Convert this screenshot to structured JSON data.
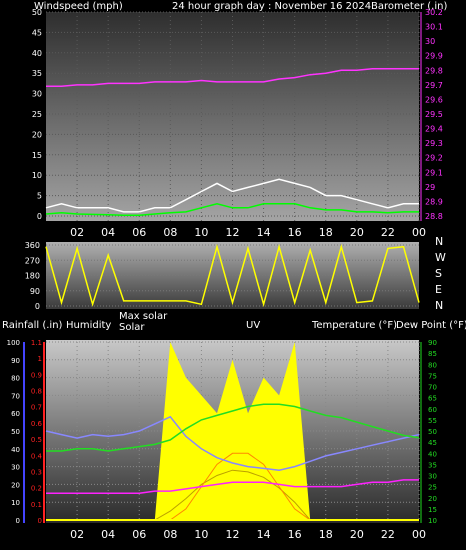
{
  "header": {
    "wind_label": "Windspeed (mph)",
    "title": "24 hour graph day : November 16 2024",
    "baro_label": "Barometer (.in)"
  },
  "x_ticks": [
    "02",
    "04",
    "06",
    "08",
    "10",
    "12",
    "14",
    "16",
    "18",
    "20",
    "22",
    "00"
  ],
  "dir_labels": [
    "N",
    "W",
    "S",
    "E",
    "N"
  ],
  "lower_labels": {
    "rain": "Rainfall (.in)",
    "humidity": "Humidity",
    "max_solar": "Max solar",
    "solar": "Solar",
    "uv": "UV",
    "temperature": "Temperature (°F)",
    "dew_point": "Dew Point (°F)"
  },
  "colors": {
    "wind_gust": "#ffffff",
    "wind_avg": "#00ff00",
    "barometer": "#ff33ff",
    "direction": "#ffff00",
    "humidity": "#8888ff",
    "temperature": "#22dd22",
    "dew_point": "#ff22ff",
    "solar": "#ffff00",
    "uv": "#ff8800",
    "rain_axis": "#ff2222",
    "humidity_axis": "#4444ff"
  },
  "chart_data": [
    {
      "type": "line",
      "title": "24 hour graph day : November 16 2024",
      "xlabel": "",
      "ylabel": "Windspeed (mph)",
      "y2label": "Barometer (.in)",
      "x": [
        0,
        1,
        2,
        3,
        4,
        5,
        6,
        7,
        8,
        9,
        10,
        11,
        12,
        13,
        14,
        15,
        16,
        17,
        18,
        19,
        20,
        21,
        22,
        23,
        24
      ],
      "ylim": [
        0,
        50
      ],
      "y2lim": [
        28.8,
        30.2
      ],
      "y_ticks": [
        0,
        5,
        10,
        15,
        20,
        25,
        30,
        35,
        40,
        45,
        50
      ],
      "y2_ticks": [
        28.8,
        28.9,
        29.0,
        29.1,
        29.2,
        29.3,
        29.4,
        29.5,
        29.6,
        29.7,
        29.8,
        29.9,
        30.0,
        30.1,
        30.2
      ],
      "y2_tick_labels": [
        "28.8",
        "28.9",
        "29",
        "29.1",
        "29.2",
        "29.3",
        "29.4",
        "29.5",
        "29.6",
        "29.7",
        "29.8",
        "29.9",
        "30",
        "30.1",
        "30.2"
      ],
      "series": [
        {
          "name": "Windspeed (mph)",
          "axis": "y",
          "values": [
            2,
            3,
            2,
            2,
            2,
            1,
            1,
            2,
            2,
            4,
            6,
            8,
            6,
            7,
            8,
            9,
            8,
            7,
            5,
            5,
            4,
            3,
            2,
            3,
            3
          ]
        },
        {
          "name": "Wind avg",
          "axis": "y",
          "values": [
            0.5,
            0.8,
            0.5,
            0.4,
            0.3,
            0.2,
            0.2,
            0.5,
            0.8,
            1,
            2,
            3,
            2,
            2,
            3,
            3,
            3,
            2,
            1.5,
            1.5,
            1,
            1,
            0.8,
            1,
            1
          ]
        },
        {
          "name": "Barometer (.in)",
          "axis": "y2",
          "values": [
            29.69,
            29.69,
            29.7,
            29.7,
            29.71,
            29.71,
            29.71,
            29.72,
            29.72,
            29.72,
            29.73,
            29.72,
            29.72,
            29.72,
            29.72,
            29.74,
            29.75,
            29.77,
            29.78,
            29.8,
            29.8,
            29.81,
            29.81,
            29.81,
            29.81
          ]
        }
      ]
    },
    {
      "type": "line",
      "title": "",
      "ylabel": "Wind direction",
      "ylim": [
        0,
        360
      ],
      "y_ticks": [
        0,
        90,
        180,
        270,
        360
      ],
      "x": [
        0,
        1,
        2,
        3,
        4,
        5,
        6,
        7,
        8,
        9,
        10,
        11,
        12,
        13,
        14,
        15,
        16,
        17,
        18,
        19,
        20,
        21,
        22,
        23,
        24
      ],
      "series": [
        {
          "name": "Direction",
          "values": [
            350,
            20,
            340,
            10,
            300,
            30,
            30,
            30,
            30,
            30,
            10,
            350,
            20,
            340,
            10,
            350,
            20,
            330,
            20,
            350,
            20,
            30,
            340,
            350,
            20
          ]
        }
      ]
    },
    {
      "type": "line",
      "title": "",
      "x": [
        0,
        1,
        2,
        3,
        4,
        5,
        6,
        7,
        8,
        9,
        10,
        11,
        12,
        13,
        14,
        15,
        16,
        17,
        18,
        19,
        20,
        21,
        22,
        23,
        24
      ],
      "rain_ticks": [
        0,
        0.1,
        0.2,
        0.3,
        0.4,
        0.5,
        0.6,
        0.7,
        0.8,
        0.9,
        1,
        1.1
      ],
      "humidity_ticks": [
        0,
        10,
        20,
        30,
        40,
        50,
        60,
        70,
        80,
        90,
        100
      ],
      "temp_ticks": [
        10,
        15,
        20,
        25,
        30,
        35,
        40,
        45,
        50,
        55,
        60,
        65,
        70,
        75,
        80,
        85,
        90
      ],
      "temp_lim": [
        10,
        90
      ],
      "humidity_lim": [
        0,
        100
      ],
      "series": [
        {
          "name": "Humidity",
          "values": [
            50,
            48,
            46,
            48,
            47,
            48,
            50,
            54,
            58,
            47,
            40,
            35,
            32,
            30,
            29,
            28,
            30,
            33,
            36,
            38,
            40,
            42,
            44,
            46,
            48
          ]
        },
        {
          "name": "Temperature (°F)",
          "values": [
            41,
            41,
            42,
            42,
            41,
            42,
            43,
            44,
            46,
            51,
            55,
            57,
            59,
            61,
            62,
            62,
            61,
            59,
            57,
            56,
            54,
            52,
            50,
            48,
            47
          ]
        },
        {
          "name": "Dew Point (°F)",
          "values": [
            22,
            22,
            22,
            22,
            22,
            22,
            22,
            23,
            23,
            24,
            25,
            26,
            27,
            27,
            27,
            26,
            25,
            25,
            25,
            25,
            26,
            27,
            27,
            28,
            28
          ]
        },
        {
          "name": "Solar",
          "values": [
            0,
            0,
            0,
            0,
            0,
            0,
            0,
            0,
            100,
            80,
            70,
            60,
            90,
            60,
            80,
            70,
            100,
            0,
            0,
            0,
            0,
            0,
            0,
            0,
            0
          ]
        },
        {
          "name": "Max solar",
          "values": [
            0,
            0,
            0,
            0,
            0,
            0,
            0,
            0,
            5,
            12,
            20,
            25,
            28,
            27,
            24,
            18,
            10,
            0,
            0,
            0,
            0,
            0,
            0,
            0,
            0
          ]
        },
        {
          "name": "UV",
          "values": [
            0,
            0,
            0,
            0,
            0,
            0,
            0,
            0,
            0,
            1,
            3,
            5,
            6,
            6,
            5,
            3,
            1,
            0,
            0,
            0,
            0,
            0,
            0,
            0,
            0
          ]
        },
        {
          "name": "Rainfall (.in)",
          "values": [
            0,
            0,
            0,
            0,
            0,
            0,
            0,
            0,
            0,
            0,
            0,
            0,
            0,
            0,
            0,
            0,
            0,
            0,
            0,
            0,
            0,
            0,
            0,
            0,
            0
          ]
        }
      ]
    }
  ]
}
